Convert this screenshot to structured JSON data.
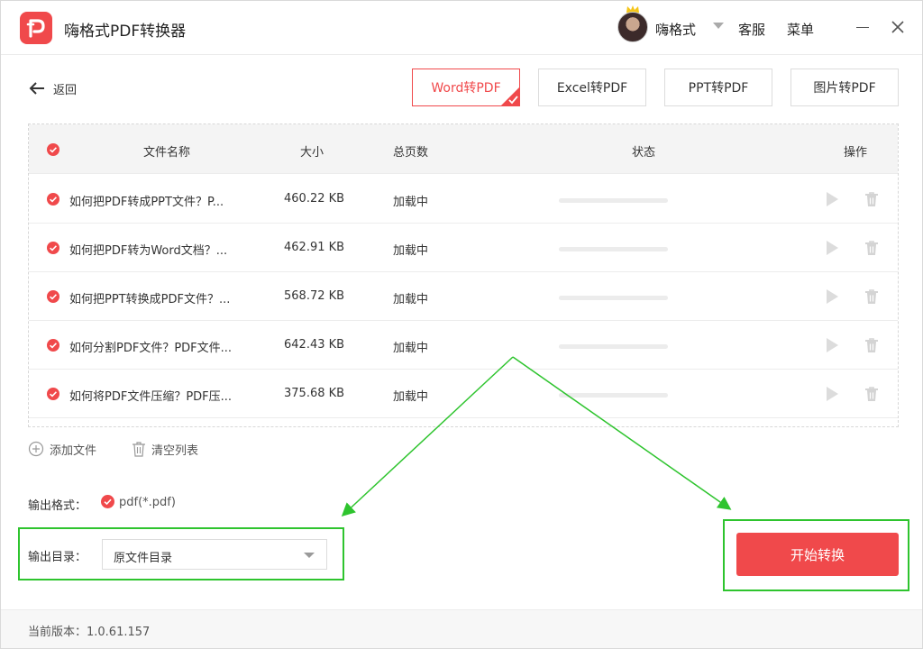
{
  "app": {
    "title": "嗨格式PDF转换器"
  },
  "header": {
    "username": "嗨格式",
    "service_label": "客服",
    "menu_label": "菜单"
  },
  "nav": {
    "back_label": "返回"
  },
  "tabs": [
    {
      "label": "Word转PDF",
      "active": true
    },
    {
      "label": "Excel转PDF",
      "active": false
    },
    {
      "label": "PPT转PDF",
      "active": false
    },
    {
      "label": "图片转PDF",
      "active": false
    }
  ],
  "table": {
    "headers": {
      "name": "文件名称",
      "size": "大小",
      "pages": "总页数",
      "status": "状态",
      "actions": "操作"
    },
    "rows": [
      {
        "name": "如何把PDF转成PPT文件？P...",
        "size": "460.22 KB",
        "pages": "加载中",
        "progress": 0
      },
      {
        "name": "如何把PDF转为Word文档？...",
        "size": "462.91 KB",
        "pages": "加载中",
        "progress": 0
      },
      {
        "name": "如何把PPT转换成PDF文件？...",
        "size": "568.72 KB",
        "pages": "加载中",
        "progress": 0
      },
      {
        "name": "如何分割PDF文件？PDF文件...",
        "size": "642.43 KB",
        "pages": "加载中",
        "progress": 0
      },
      {
        "name": "如何将PDF文件压缩？PDF压...",
        "size": "375.68 KB",
        "pages": "加载中",
        "progress": 0
      }
    ]
  },
  "actions": {
    "add_file": "添加文件",
    "clear_list": "清空列表"
  },
  "output": {
    "format_label": "输出格式：",
    "format_value": "pdf(*.pdf)",
    "dir_label": "输出目录：",
    "dir_value": "原文件目录"
  },
  "start_button": "开始转换",
  "footer": {
    "version": "当前版本：1.0.61.157"
  },
  "colors": {
    "accent": "#f0494b",
    "highlight": "#2ec42e"
  }
}
